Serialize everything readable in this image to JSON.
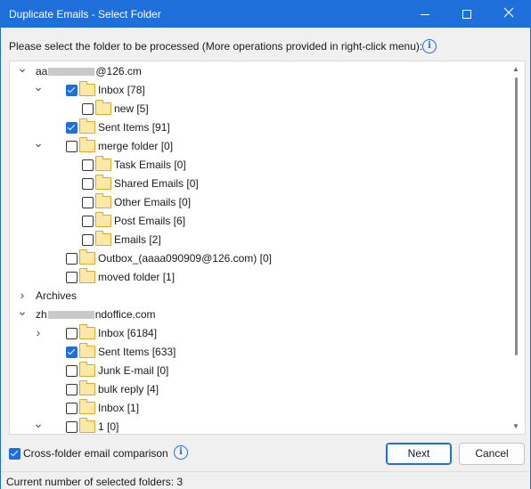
{
  "window": {
    "title": "Duplicate Emails - Select Folder",
    "accent_color": "#1e6fd9",
    "controls": [
      "minimize-icon",
      "maximize-icon",
      "close-icon"
    ]
  },
  "prompt": "Please select the folder to be processed (More operations provided in right-click menu):",
  "tree": {
    "rows": [
      {
        "level": 0,
        "expander": "expanded",
        "checkbox": null,
        "folder": false,
        "label_pre": "aa",
        "label_post": "@126.cm",
        "obscured": true
      },
      {
        "level": 1,
        "expander": "expanded",
        "checkbox": true,
        "folder": true,
        "label": "Inbox [78]"
      },
      {
        "level": 2,
        "expander": null,
        "checkbox": false,
        "folder": true,
        "label": "new [5]"
      },
      {
        "level": 1,
        "expander": null,
        "checkbox": true,
        "folder": true,
        "label": "Sent Items [91]"
      },
      {
        "level": 1,
        "expander": "expanded",
        "checkbox": false,
        "folder": true,
        "label": "merge folder [0]"
      },
      {
        "level": 2,
        "expander": null,
        "checkbox": false,
        "folder": true,
        "label": "Task Emails [0]"
      },
      {
        "level": 2,
        "expander": null,
        "checkbox": false,
        "folder": true,
        "label": "Shared Emails [0]"
      },
      {
        "level": 2,
        "expander": null,
        "checkbox": false,
        "folder": true,
        "label": "Other Emails [0]"
      },
      {
        "level": 2,
        "expander": null,
        "checkbox": false,
        "folder": true,
        "label": "Post Emails [6]"
      },
      {
        "level": 2,
        "expander": null,
        "checkbox": false,
        "folder": true,
        "label": "Emails [2]"
      },
      {
        "level": 1,
        "expander": null,
        "checkbox": false,
        "folder": true,
        "label": "Outbox_(aaaa090909@126.com) [0]"
      },
      {
        "level": 1,
        "expander": null,
        "checkbox": false,
        "folder": true,
        "label": "moved folder [1]"
      },
      {
        "level": 0,
        "expander": "collapsed",
        "checkbox": null,
        "folder": false,
        "label": "Archives"
      },
      {
        "level": 0,
        "expander": "expanded",
        "checkbox": null,
        "folder": false,
        "label_pre": "zh",
        "label_post": "ndoffice.com",
        "obscured": true
      },
      {
        "level": 1,
        "expander": "collapsed",
        "checkbox": false,
        "folder": true,
        "label": " Inbox [6184]"
      },
      {
        "level": 1,
        "expander": null,
        "checkbox": true,
        "folder": true,
        "label": "Sent Items [633]"
      },
      {
        "level": 1,
        "expander": null,
        "checkbox": false,
        "folder": true,
        "label": "Junk E-mail [0]"
      },
      {
        "level": 1,
        "expander": null,
        "checkbox": false,
        "folder": true,
        "label": "bulk reply [4]"
      },
      {
        "level": 1,
        "expander": null,
        "checkbox": false,
        "folder": true,
        "label": "Inbox [1]"
      },
      {
        "level": 1,
        "expander": "expanded",
        "checkbox": false,
        "folder": true,
        "label": "1 [0]"
      }
    ]
  },
  "cross_folder": {
    "label": "Cross-folder email comparison",
    "checked": true
  },
  "buttons": {
    "next": "Next",
    "cancel": "Cancel"
  },
  "status": "Current number of selected folders: 3"
}
